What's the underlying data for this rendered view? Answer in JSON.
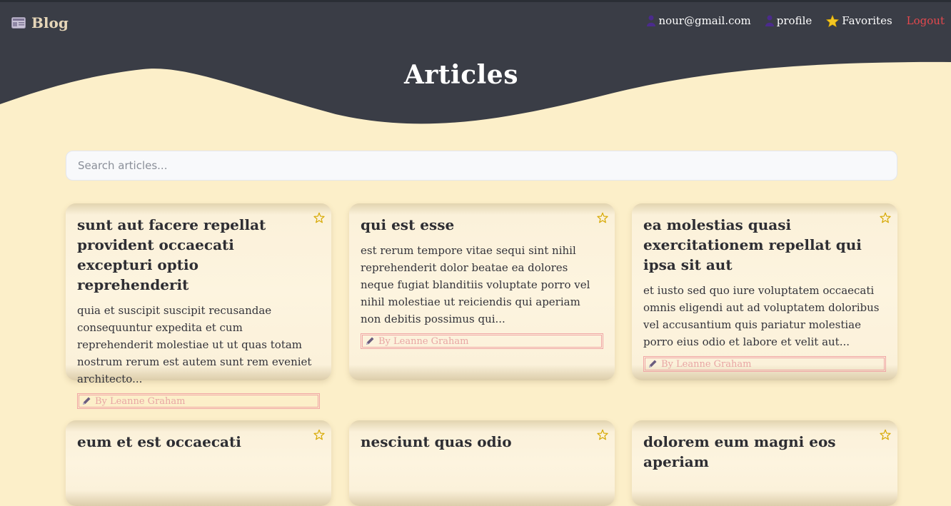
{
  "brand": {
    "name": "Blog",
    "icon": "newspaper-icon"
  },
  "nav": {
    "email": "nour@gmail.com",
    "profile": "profile",
    "favorites": "Favorites",
    "logout": "Logout"
  },
  "page": {
    "title": "Articles"
  },
  "search": {
    "placeholder": "Search articles..."
  },
  "colors": {
    "header": "#3a3d46",
    "background": "#fcefc9",
    "logout": "#e5484d",
    "author": "#e8a6a4",
    "star": "#d6a800"
  },
  "articles": [
    {
      "title": "sunt aut facere repellat provident occaecati excepturi optio reprehenderit",
      "body": "quia et suscipit suscipit recusandae consequuntur expedita et cum reprehenderit molestiae ut ut quas totam nostrum rerum est autem sunt rem eveniet architecto...",
      "author": "By Leanne Graham"
    },
    {
      "title": "qui est esse",
      "body": "est rerum tempore vitae sequi sint nihil reprehenderit dolor beatae ea dolores neque fugiat blanditiis voluptate porro vel nihil molestiae ut reiciendis qui aperiam non debitis possimus qui...",
      "author": "By Leanne Graham"
    },
    {
      "title": "ea molestias quasi exercitationem repellat qui ipsa sit aut",
      "body": "et iusto sed quo iure voluptatem occaecati omnis eligendi aut ad voluptatem doloribus vel accusantium quis pariatur molestiae porro eius odio et labore et velit aut...",
      "author": "By Leanne Graham"
    },
    {
      "title": "eum et est occaecati"
    },
    {
      "title": "nesciunt quas odio"
    },
    {
      "title": "dolorem eum magni eos aperiam"
    }
  ]
}
